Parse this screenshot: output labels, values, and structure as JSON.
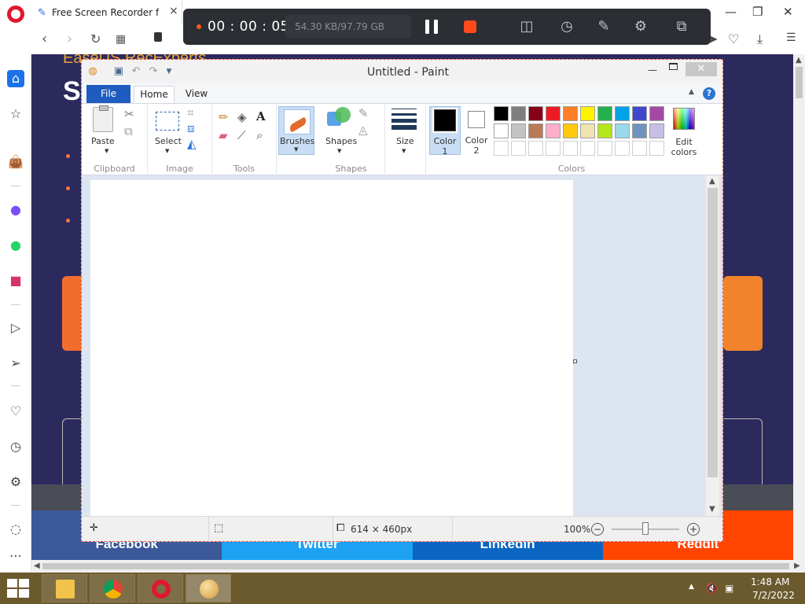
{
  "browser": {
    "tab": {
      "title": "Free Screen Recorder for P",
      "close": "×"
    },
    "nav": {
      "back": "‹",
      "forward": "›",
      "reload": "↻"
    },
    "window_controls": {
      "minimize": "—",
      "maximize": "❐",
      "close": "✕"
    }
  },
  "recorder": {
    "time": "00 : 00 : 05",
    "size": "54.30 KB/97.79 GB",
    "icons": [
      "camera-icon",
      "timer-icon",
      "pen-icon",
      "gear-icon",
      "crop-icon"
    ]
  },
  "webpage": {
    "heading": "EaseUS RecExperts",
    "big_letter": "S",
    "share_buttons": [
      "Facebook",
      "Twitter",
      "Linkedin",
      "Reddit"
    ]
  },
  "paint": {
    "title": "Untitled - Paint",
    "tabs": [
      "File",
      "Home",
      "View"
    ],
    "help": "?",
    "groups": {
      "clipboard": {
        "label": "Clipboard",
        "paste": "Paste"
      },
      "image": {
        "label": "Image",
        "select": "Select"
      },
      "tools": {
        "label": "Tools"
      },
      "brushes": {
        "label": "Brushes"
      },
      "shapes": {
        "label": "Shapes",
        "button": "Shapes"
      },
      "size": {
        "label": "Size"
      },
      "colors": {
        "label": "Colors",
        "color1": "Color 1",
        "color2": "Color 2",
        "edit": "Edit colors"
      }
    },
    "palette": [
      "#000000",
      "#7f7f7f",
      "#880015",
      "#ed1c24",
      "#ff7f27",
      "#fff200",
      "#22b14c",
      "#00a2e8",
      "#3f48cc",
      "#a349a4",
      "#ffffff",
      "#c3c3c3",
      "#b97a57",
      "#ffaec9",
      "#ffc90e",
      "#efe4b0",
      "#b5e61d",
      "#99d9ea",
      "#7092be",
      "#c8bfe7"
    ],
    "status": {
      "dimensions": "614 × 460px",
      "zoom": "100%"
    }
  },
  "taskbar": {
    "time": "1:48 AM",
    "date": "7/2/2022",
    "apps": [
      "file-explorer",
      "chrome",
      "opera",
      "paint"
    ]
  }
}
